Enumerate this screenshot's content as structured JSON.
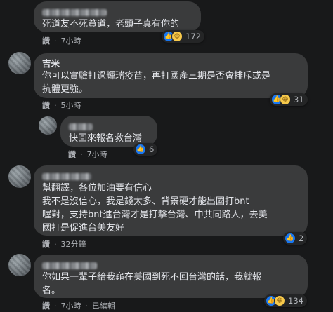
{
  "comments": [
    {
      "name": "",
      "text": "死道友不死貧道，老頭子真有你的",
      "like_label": "讚",
      "time": "7小時",
      "reactions": [
        "like",
        "haha"
      ],
      "reaction_count": "172"
    },
    {
      "name": "吉米",
      "text": "你可以實驗打過輝瑞疫苗，再打國產三期是否會排斥或是\n抗體更強。",
      "like_label": "讚",
      "time": "5小時",
      "reactions": [
        "like",
        "haha"
      ],
      "reaction_count": "31"
    },
    {
      "name": "",
      "text": "快回來報名救台灣",
      "like_label": "讚",
      "time": "7小時",
      "reactions": [
        "like"
      ],
      "reaction_count": "6"
    },
    {
      "name": "",
      "text": "幫翻譯，各位加油要有信心\n我不是沒信心，我是錢太多、背景硬才能出國打bnt\n喔對，支持bnt進台灣才是打擊台灣、中共同路人，去美\n國打是促進台美友好",
      "like_label": "讚",
      "time": "32分鐘",
      "reactions": [
        "like"
      ],
      "reaction_count": "2"
    },
    {
      "name": "",
      "text": "你如果一輩子給我龜在美國到死不回台灣的話，我就報\n名。",
      "like_label": "讚",
      "time": "7小時",
      "edited": "已編輯",
      "reactions": [
        "like",
        "haha"
      ],
      "reaction_count": "134"
    }
  ]
}
